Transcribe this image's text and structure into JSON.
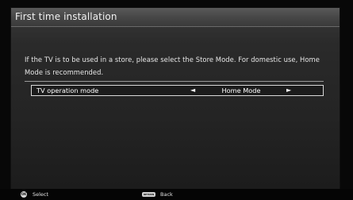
{
  "dialog": {
    "title": "First time installation",
    "description": "If the TV is to be used in a store, please select the Store Mode. For domestic use, Home Mode is recommended."
  },
  "setting": {
    "label": "TV operation mode",
    "value": "Home Mode",
    "left_arrow": "◄",
    "right_arrow": "►"
  },
  "footer": {
    "select_label": "Select",
    "select_icon_text": "OK",
    "back_label": "Back",
    "back_icon_text": "RETURN"
  },
  "icons": {
    "left": "left-arrow-icon",
    "right": "right-arrow-icon",
    "ok": "ok-button-icon",
    "return": "return-button-icon"
  },
  "colors": {
    "panel": "#2a2a2a",
    "title_bar": "#474747",
    "text": "#ffffff",
    "highlight_border": "#d8d8d8"
  }
}
